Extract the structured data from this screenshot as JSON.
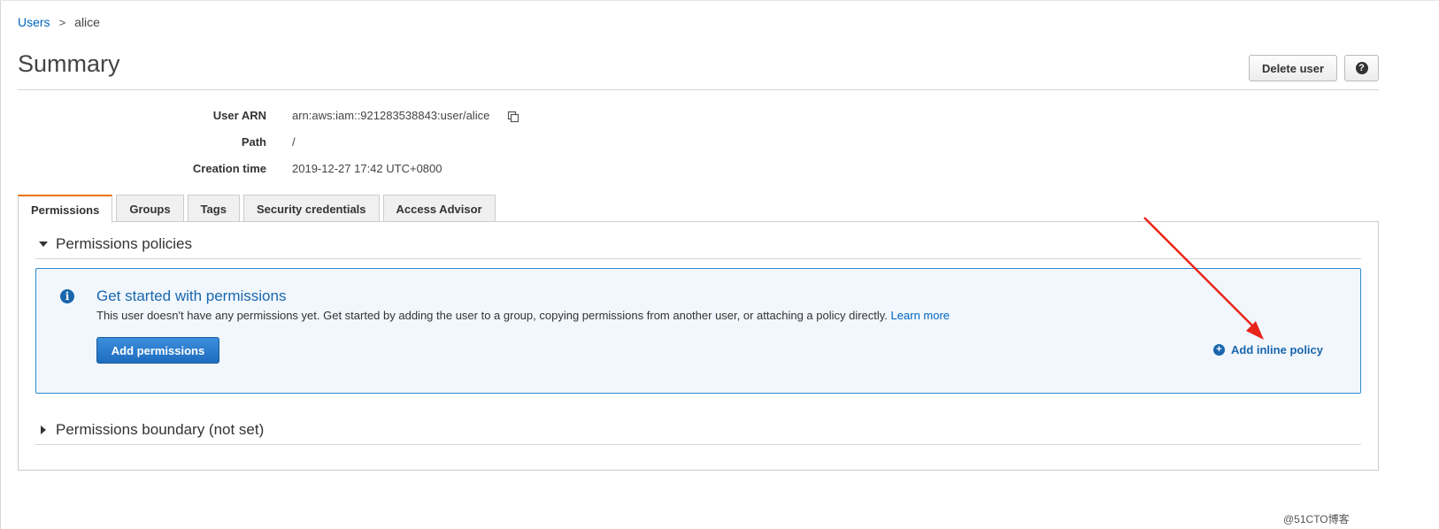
{
  "breadcrumb": {
    "parent": "Users",
    "separator": ">",
    "current": "alice"
  },
  "page": {
    "title": "Summary"
  },
  "header_buttons": {
    "delete_label": "Delete user",
    "help_glyph": "?"
  },
  "user_info": {
    "arn_label": "User ARN",
    "arn_value": "arn:aws:iam::921283538843:user/alice",
    "path_label": "Path",
    "path_value": "/",
    "creation_label": "Creation time",
    "creation_value": "2019-12-27 17:42 UTC+0800"
  },
  "tabs": [
    {
      "label": "Permissions",
      "active": true
    },
    {
      "label": "Groups",
      "active": false
    },
    {
      "label": "Tags",
      "active": false
    },
    {
      "label": "Security credentials",
      "active": false
    },
    {
      "label": "Access Advisor",
      "active": false
    }
  ],
  "permissions": {
    "policies_heading": "Permissions policies",
    "alert_title": "Get started with permissions",
    "alert_text": "This user doesn't have any permissions yet. Get started by adding the user to a group, copying permissions from another user, or attaching a policy directly.",
    "learn_more": "Learn more",
    "add_permissions_label": "Add permissions",
    "add_inline_label": "Add inline policy",
    "boundary_heading": "Permissions boundary (not set)"
  },
  "icons": {
    "copy": "copy-icon",
    "info": "info-icon",
    "plus": "plus-circle-icon",
    "help": "help-icon"
  },
  "colors": {
    "link": "#0066c0",
    "accent_tab": "#ec7211",
    "primary_button": "#1f6cbf",
    "alert_border": "#2d8bd0",
    "annotation_arrow": "#e8231a"
  },
  "watermark": "@51CTO博客"
}
